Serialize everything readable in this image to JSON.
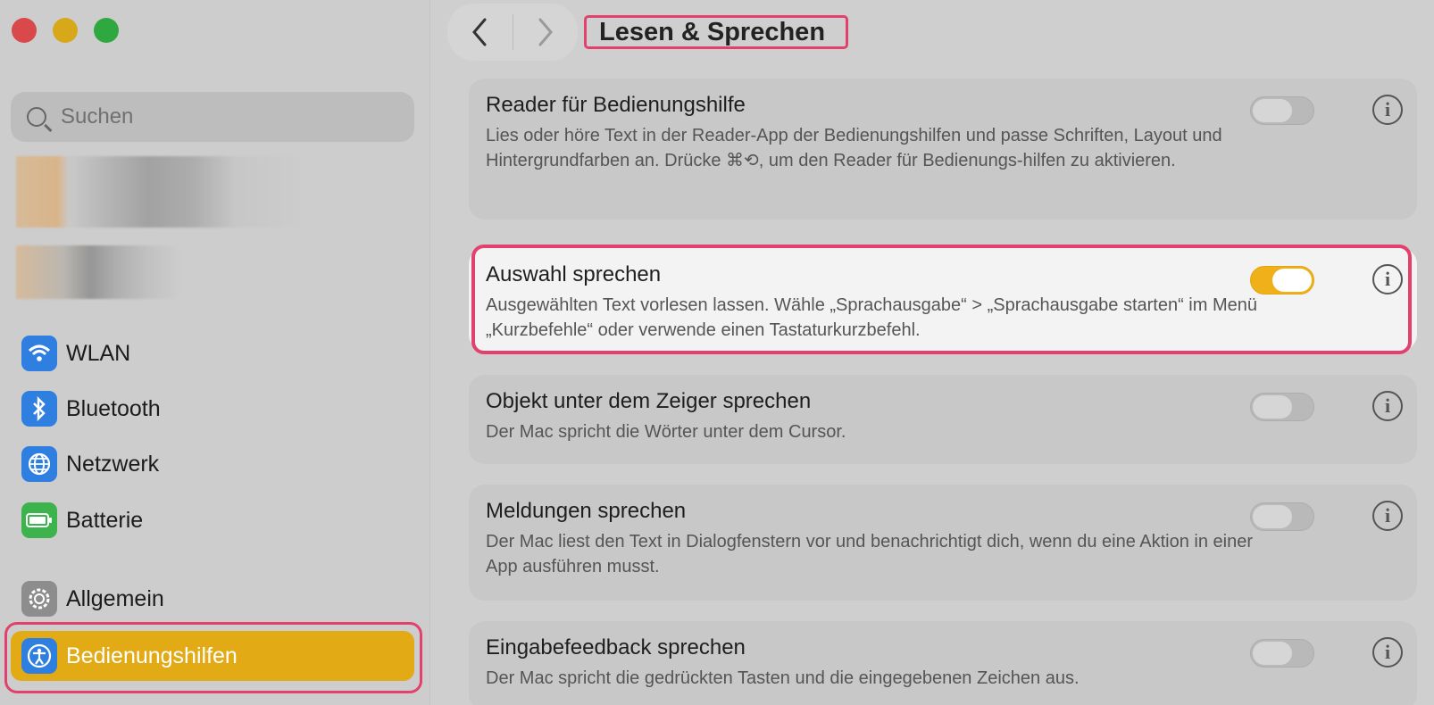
{
  "window": {
    "title": "Lesen & Sprechen"
  },
  "sidebar": {
    "search_placeholder": "Suchen",
    "items": [
      {
        "label": "WLAN",
        "icon": "wifi-icon"
      },
      {
        "label": "Bluetooth",
        "icon": "bluetooth-icon"
      },
      {
        "label": "Netzwerk",
        "icon": "globe-icon"
      },
      {
        "label": "Batterie",
        "icon": "battery-icon"
      },
      {
        "label": "Allgemein",
        "icon": "gear-icon"
      },
      {
        "label": "Bedienungshilfen",
        "icon": "accessibility-icon",
        "selected": true
      }
    ]
  },
  "nav": {
    "back": "‹",
    "forward": "›"
  },
  "settings": [
    {
      "title": "Reader für Bedienungshilfe",
      "description": "Lies oder höre Text in der Reader-App der Bedienungshilfen und passe Schriften, Layout und Hintergrundfarben an. Drücke ⌘⟲, um den Reader für Bedienungs-hilfen zu aktivieren.",
      "enabled": false
    },
    {
      "title": "Auswahl sprechen",
      "description": "Ausgewählten Text vorlesen lassen. Wähle „Sprachausgabe“ > „Sprachausgabe starten“ im Menü „Kurzbefehle“ oder verwende einen Tastaturkurzbefehl.",
      "enabled": true
    },
    {
      "title": "Objekt unter dem Zeiger sprechen",
      "description": "Der Mac spricht die Wörter unter dem Cursor.",
      "enabled": false
    },
    {
      "title": "Meldungen sprechen",
      "description": "Der Mac liest den Text in Dialogfenstern vor und benachrichtigt dich, wenn du eine Aktion in einer App ausführen musst.",
      "enabled": false
    },
    {
      "title": "Eingabefeedback sprechen",
      "description": "Der Mac spricht die gedrückten Tasten und die eingegebenen Zeichen aus.",
      "enabled": false
    }
  ],
  "colors": {
    "accent": "#e2ab16",
    "highlight": "#e2416e"
  }
}
